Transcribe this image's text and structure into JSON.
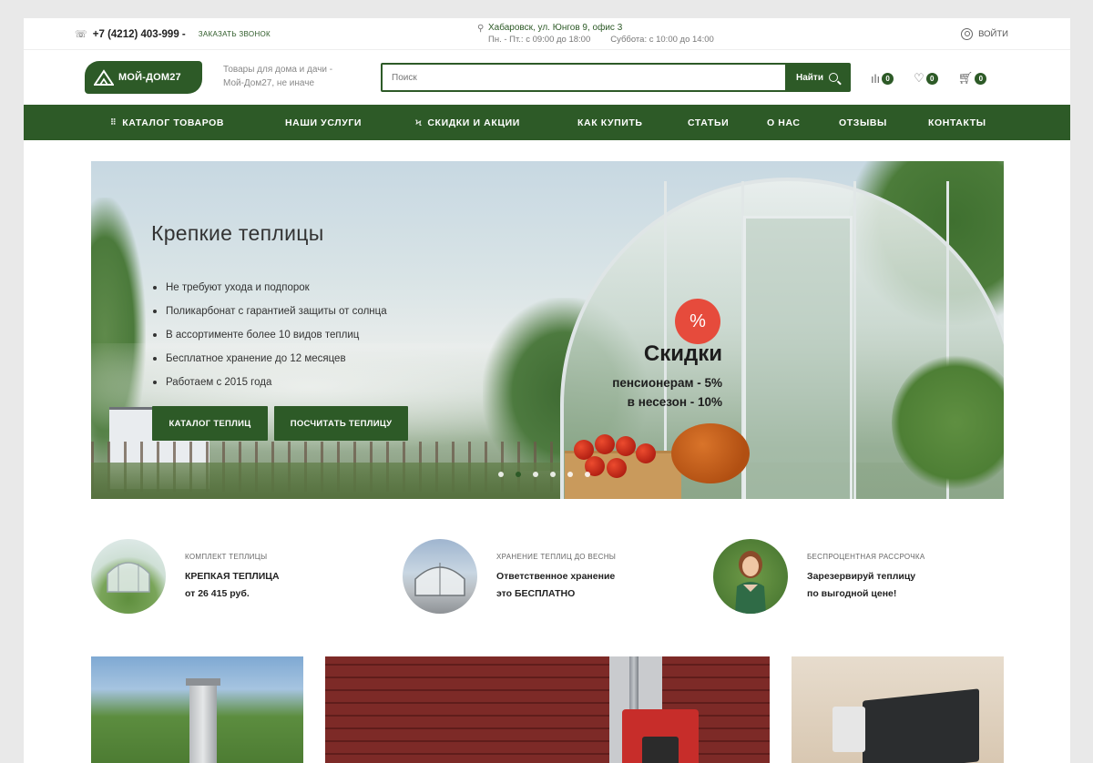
{
  "topbar": {
    "phone": "+7 (4212) 403-999 -",
    "callback": "заказать звонок",
    "address": "Хабаровск, ул. Юнгов 9, офис 3",
    "hours_weekday": "Пн. - Пт.: с 09:00 до 18:00",
    "hours_saturday": "Суббота: с 10:00 до 14:00",
    "login": "войти"
  },
  "header": {
    "logo_text": "МОЙ-ДОМ27",
    "tagline": "Товары для дома и дачи - Мой-Дом27, не иначе",
    "search_placeholder": "Поиск",
    "search_button": "Найти",
    "compare_count": "0",
    "favorites_count": "0",
    "cart_count": "0"
  },
  "nav": [
    {
      "label": "Каталог товаров",
      "icon": "grid-icon"
    },
    {
      "label": "Наши услуги"
    },
    {
      "label": "Скидки и акции",
      "icon": "lightning-icon"
    },
    {
      "label": "Как купить"
    },
    {
      "label": "Статьи"
    },
    {
      "label": "О нас"
    },
    {
      "label": "Отзывы"
    },
    {
      "label": "Контакты"
    }
  ],
  "hero": {
    "title": "Крепкие теплицы",
    "bullets": [
      "Не требуют ухода и подпорок",
      "Поликарбонат с гарантией защиты от солнца",
      "В ассортименте более 10 видов теплиц",
      "Бесплатное хранение до 12 месяцев",
      "Работаем с 2015 года"
    ],
    "btn_catalog": "Каталог теплиц",
    "btn_calc": "Посчитать теплицу",
    "promo_symbol": "%",
    "promo_title": "Скидки",
    "promo_line1": "пенсионерам - 5%",
    "promo_line2": "в несезон - 10%",
    "slides_total": 6,
    "slide_active": 2
  },
  "features": [
    {
      "caption": "Комплект теплицы",
      "line1": "КРЕПКАЯ ТЕПЛИЦА",
      "line2": "от 26 415 руб."
    },
    {
      "caption": "Хранение теплиц до весны",
      "line1": "Ответственное хранение",
      "line2": "это БЕСПЛАТНО"
    },
    {
      "caption": "Беспроцентная рассрочка",
      "line1": "Зарезервируй теплицу",
      "line2": "по выгодной цене!"
    }
  ],
  "colors": {
    "brand_green": "#2d5a27",
    "promo_red": "#e64b3c"
  }
}
